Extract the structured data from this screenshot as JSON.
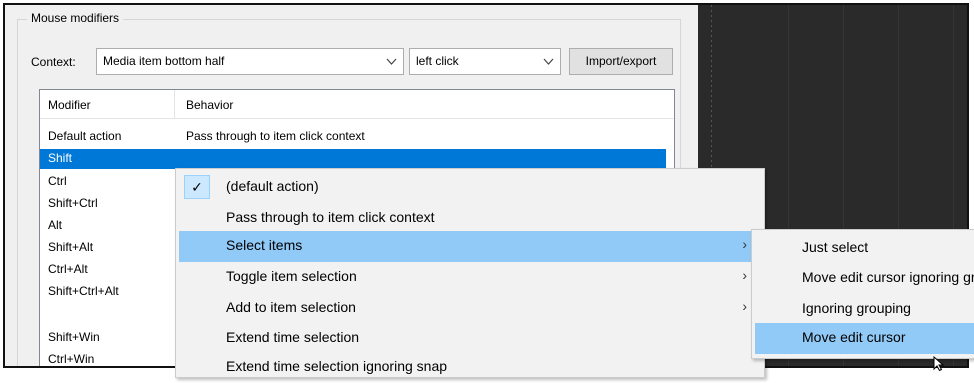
{
  "group": {
    "title": "Mouse modifiers"
  },
  "context": {
    "label": "Context:",
    "combo1": "Media item bottom half",
    "combo2": "left click",
    "import_export": "Import/export"
  },
  "table": {
    "headers": [
      "Modifier",
      "Behavior"
    ],
    "rows": [
      {
        "modifier": "Default action",
        "behavior": "Pass through to item click context"
      },
      {
        "modifier": "Shift",
        "behavior": ""
      },
      {
        "modifier": "Ctrl",
        "behavior": ""
      },
      {
        "modifier": "Shift+Ctrl",
        "behavior": ""
      },
      {
        "modifier": "Alt",
        "behavior": ""
      },
      {
        "modifier": "Shift+Alt",
        "behavior": ""
      },
      {
        "modifier": "Ctrl+Alt",
        "behavior": ""
      },
      {
        "modifier": "Shift+Ctrl+Alt",
        "behavior": ""
      },
      {
        "modifier": "",
        "behavior": ""
      },
      {
        "modifier": "Shift+Win",
        "behavior": ""
      },
      {
        "modifier": "Ctrl+Win",
        "behavior": ""
      }
    ]
  },
  "menu": {
    "check_glyph": "✓",
    "submenu_glyph": "›",
    "items": [
      {
        "label": "(default action)"
      },
      {
        "label": "Pass through to item click context"
      },
      {
        "label": "Select items"
      },
      {
        "label": "Toggle item selection"
      },
      {
        "label": "Add to item selection"
      },
      {
        "label": "Extend time selection"
      },
      {
        "label": "Extend time selection ignoring snap"
      }
    ]
  },
  "submenu": {
    "items": [
      {
        "label": "Just select"
      },
      {
        "label": "Move edit cursor ignoring grouping"
      },
      {
        "label": "Ignoring grouping"
      },
      {
        "label": "Move edit cursor"
      }
    ]
  },
  "colors": {
    "selection": "#0078d7",
    "menu_highlight": "#91c9f7",
    "arrange_bg": "#2a2a2a"
  }
}
